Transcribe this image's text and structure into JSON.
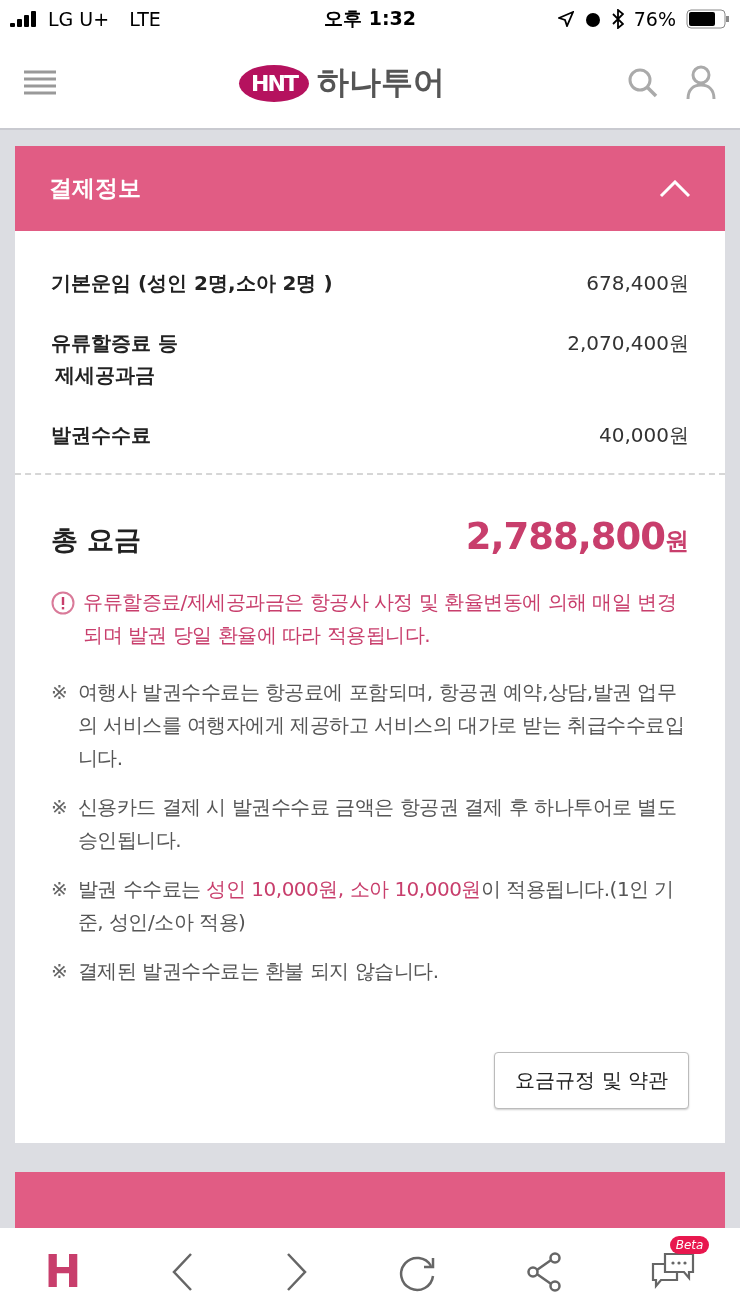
{
  "status_bar": {
    "carrier": "LG U+",
    "network": "LTE",
    "time": "오후 1:32",
    "battery": "76%"
  },
  "header": {
    "logo_badge": "HNT",
    "logo_text": "하나투어"
  },
  "payment": {
    "title": "결제정보",
    "expanded": true,
    "rows": [
      {
        "label": [
          "기본운임 (성인 2명,소아 2명 )"
        ],
        "amount": "678,400원"
      },
      {
        "label": [
          "유류할증료 등",
          "제세공과금"
        ],
        "amount": "2,070,400원"
      },
      {
        "label": [
          "발권수수료"
        ],
        "amount": "40,000원"
      }
    ],
    "total": {
      "label": "총 요금",
      "amount": "2,788,800",
      "unit": "원"
    },
    "warning": "유류할증료/제세공과금은 항공사 사정 및 환율변동에 의해 매일 변경되며 발권 당일 환율에 따라 적용됩니다.",
    "notes": [
      {
        "mark": "※",
        "parts": [
          {
            "text": "여행사 발권수수료는 항공료에 포함되며, 항공권 예약,상담,발권 업무의 서비스를 여행자에게 제공하고 서비스의 대가로 받는 취급수수료입니다.",
            "highlight": false
          }
        ]
      },
      {
        "mark": "※",
        "parts": [
          {
            "text": "신용카드 결제 시 발권수수료 금액은 항공권 결제 후 하나투어로 별도 승인됩니다.",
            "highlight": false
          }
        ]
      },
      {
        "mark": "※",
        "parts": [
          {
            "text": "발권 수수료는 ",
            "highlight": false
          },
          {
            "text": "성인 10,000원, 소아 10,000원",
            "highlight": true
          },
          {
            "text": "이 적용됩니다.(1인 기준, 성인/소아 적용)",
            "highlight": false
          }
        ]
      },
      {
        "mark": "※",
        "parts": [
          {
            "text": "결제된 발권수수료는 환불 되지 않습니다.",
            "highlight": false
          }
        ]
      }
    ],
    "button": "요금규정 및 약관"
  },
  "next_section": {
    "expanded": false
  },
  "bottom_bar": {
    "home": "H",
    "beta_badge": "Beta"
  }
}
